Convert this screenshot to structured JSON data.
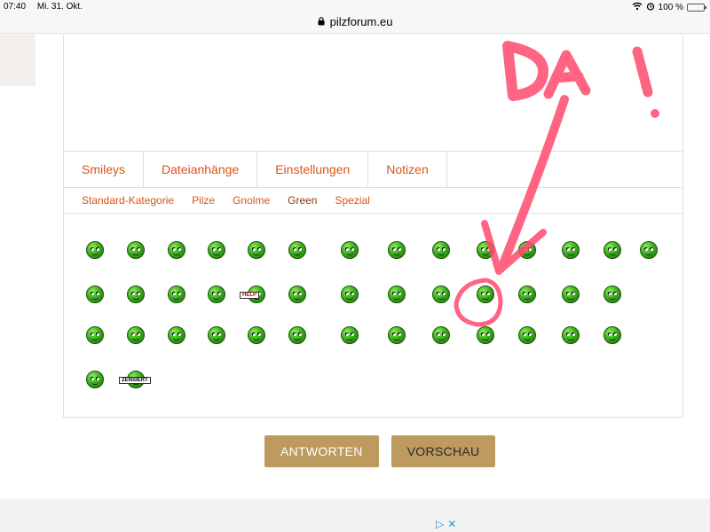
{
  "status": {
    "time": "07:40",
    "date": "Mi. 31. Okt.",
    "battery": "100 %"
  },
  "browser": {
    "url": "pilzforum.eu"
  },
  "tabs": [
    {
      "label": "Smileys",
      "active": true
    },
    {
      "label": "Dateianhänge",
      "active": false
    },
    {
      "label": "Einstellungen",
      "active": false
    },
    {
      "label": "Notizen",
      "active": false
    }
  ],
  "subtabs": [
    {
      "label": "Standard-Kategorie"
    },
    {
      "label": "Pilze"
    },
    {
      "label": "Gnolme"
    },
    {
      "label": "Green"
    },
    {
      "label": "Spezial"
    }
  ],
  "smiley_names": [
    "smile",
    "grin",
    "neutral",
    "teeth",
    "arrow",
    "mower",
    "clap",
    "sick",
    "happy",
    "wave",
    "sunglasses",
    "wink",
    "confused",
    "eek",
    "laugh",
    "tongue",
    "cry",
    "wheel",
    "help",
    "run",
    "idea",
    "winky",
    "pacman",
    "silly",
    "shock",
    "surprise",
    "clappy",
    "cool",
    "eyes",
    "music",
    "sleepy",
    "beard",
    "glare",
    "pink",
    "devil",
    "horn",
    "ref",
    "boxer",
    "green",
    "bomb",
    "hide",
    "zensiert"
  ],
  "smiley_labels": {
    "help": "HELP",
    "zensiert": "ZENSIERT"
  },
  "buttons": {
    "reply": "ANTWORTEN",
    "preview": "VORSCHAU"
  },
  "annotation": {
    "text": "DA !",
    "color": "#ff4a6e"
  },
  "colors": {
    "link": "#d9551a",
    "button": "#bd9a5e"
  },
  "ad": {
    "text": "▷✕"
  }
}
